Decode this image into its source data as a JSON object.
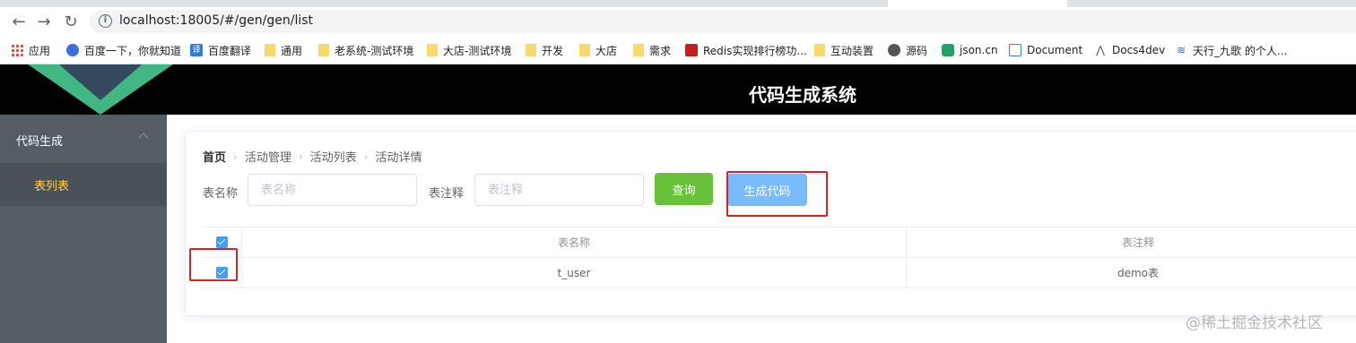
{
  "browser": {
    "url_host": "localhost:18005",
    "url_path": "/#/gen/gen/list",
    "bookmarks": [
      {
        "label": "应用",
        "icon": "apps-grid-icon"
      },
      {
        "label": "百度一下，你就知道",
        "icon": "baidu-paw-icon"
      },
      {
        "label": "百度翻译",
        "icon": "translate-icon"
      },
      {
        "label": "通用",
        "icon": "folder-icon"
      },
      {
        "label": "老系统-测试环境",
        "icon": "folder-icon"
      },
      {
        "label": "大店-测试环境",
        "icon": "folder-icon"
      },
      {
        "label": "开发",
        "icon": "folder-icon"
      },
      {
        "label": "大店",
        "icon": "folder-icon"
      },
      {
        "label": "需求",
        "icon": "folder-icon"
      },
      {
        "label": "Redis实现排行榜功...",
        "icon": "redis-icon"
      },
      {
        "label": "互动装置",
        "icon": "folder-icon"
      },
      {
        "label": "源码",
        "icon": "github-icon"
      },
      {
        "label": "json.cn",
        "icon": "json-icon"
      },
      {
        "label": "Document",
        "icon": "document-icon"
      },
      {
        "label": "Docs4dev",
        "icon": "docs4dev-icon"
      },
      {
        "label": "天行_九歌 的个人...",
        "icon": "tianxing-icon"
      }
    ]
  },
  "header": {
    "title": "代码生成系统"
  },
  "sidebar": {
    "group_label": "代码生成",
    "items": [
      {
        "label": "表列表",
        "active": true
      }
    ],
    "active_color": "#ffd04b"
  },
  "breadcrumb": [
    "首页",
    "活动管理",
    "活动列表",
    "活动详情"
  ],
  "search": {
    "table_name_label": "表名称",
    "table_name_placeholder": "表名称",
    "table_comment_label": "表注释",
    "table_comment_placeholder": "表注释",
    "query_button": "查询",
    "generate_button": "生成代码"
  },
  "table": {
    "columns": [
      "表名称",
      "表注释"
    ],
    "header_checked": true,
    "rows": [
      {
        "checked": true,
        "table_name": "t_user",
        "table_comment": "demo表"
      }
    ]
  },
  "watermark": "@稀土掘金技术社区",
  "colors": {
    "query_button": "#67c23a",
    "generate_button": "#79bbff",
    "checkbox": "#409eff",
    "highlight": "#e02020"
  }
}
